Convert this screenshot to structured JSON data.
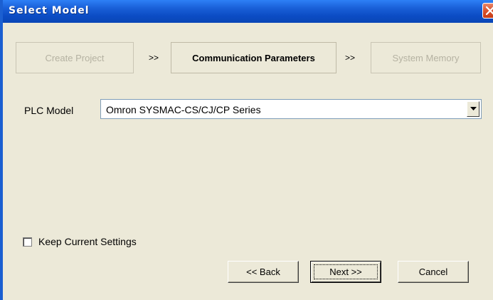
{
  "window": {
    "title": "Select Model"
  },
  "steps": [
    {
      "label": "Create Project",
      "state": "disabled"
    },
    {
      "label": "Communication Parameters",
      "state": "active"
    },
    {
      "label": "System Memory",
      "state": "disabled"
    }
  ],
  "step_separator": ">>",
  "plc": {
    "label": "PLC Model",
    "selected": "Omron SYSMAC-CS/CJ/CP Series"
  },
  "keep_settings": {
    "label": "Keep Current Settings",
    "checked": false
  },
  "buttons": {
    "back": "<< Back",
    "next": "Next >>",
    "cancel": "Cancel"
  },
  "colors": {
    "titlebar": "#0b4cc4",
    "dialog_bg": "#ece9d8",
    "close_button": "#d9532e"
  },
  "icons": {
    "close": "close-icon",
    "dropdown": "chevron-down-icon"
  }
}
